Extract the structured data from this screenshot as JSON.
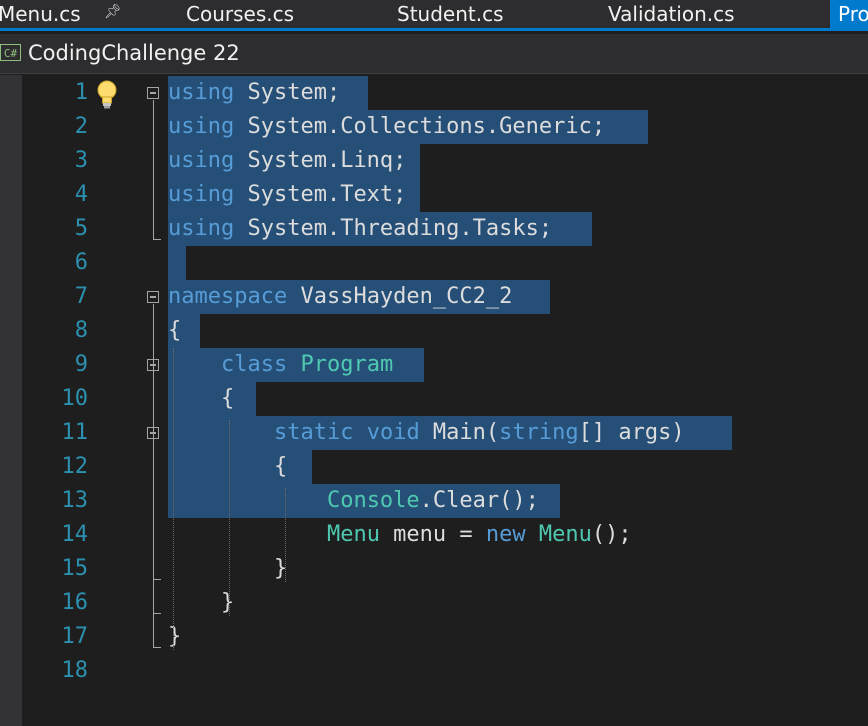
{
  "tabs": [
    {
      "label": "Menu.cs"
    },
    {
      "label": "Courses.cs"
    },
    {
      "label": "Student.cs"
    },
    {
      "label": "Validation.cs"
    },
    {
      "label": "Pro"
    }
  ],
  "pin_icon": "pin-icon",
  "navbar": {
    "language_badge": "C#",
    "project": "CodingChallenge 22"
  },
  "editor": {
    "line_numbers": [
      "1",
      "2",
      "3",
      "4",
      "5",
      "6",
      "7",
      "8",
      "9",
      "10",
      "11",
      "12",
      "13",
      "14",
      "15",
      "16",
      "17",
      "18"
    ],
    "lines": [
      [
        {
          "t": "using",
          "c": "kw"
        },
        {
          "t": " System;"
        }
      ],
      [
        {
          "t": "using",
          "c": "kw"
        },
        {
          "t": " System.Collections.Generic;"
        }
      ],
      [
        {
          "t": "using",
          "c": "kw"
        },
        {
          "t": " System.Linq;"
        }
      ],
      [
        {
          "t": "using",
          "c": "kw"
        },
        {
          "t": " System.Text;"
        }
      ],
      [
        {
          "t": "using",
          "c": "kw"
        },
        {
          "t": " System.Threading.Tasks;"
        }
      ],
      [],
      [
        {
          "t": "namespace",
          "c": "kw"
        },
        {
          "t": " VassHayden_CC2_2"
        }
      ],
      [
        {
          "t": "{"
        }
      ],
      [
        {
          "t": "    "
        },
        {
          "t": "class",
          "c": "kw"
        },
        {
          "t": " "
        },
        {
          "t": "Program",
          "c": "ty"
        }
      ],
      [
        {
          "t": "    {"
        }
      ],
      [
        {
          "t": "        "
        },
        {
          "t": "static",
          "c": "kw"
        },
        {
          "t": " "
        },
        {
          "t": "void",
          "c": "kw"
        },
        {
          "t": " Main("
        },
        {
          "t": "string",
          "c": "kw"
        },
        {
          "t": "[] args)"
        }
      ],
      [
        {
          "t": "        {"
        }
      ],
      [
        {
          "t": "            "
        },
        {
          "t": "Console",
          "c": "ty"
        },
        {
          "t": ".Clear();"
        }
      ],
      [
        {
          "t": "            "
        },
        {
          "t": "Menu",
          "c": "ty"
        },
        {
          "t": " menu = "
        },
        {
          "t": "new",
          "c": "kw"
        },
        {
          "t": " "
        },
        {
          "t": "Menu",
          "c": "ty"
        },
        {
          "t": "();"
        }
      ],
      [
        {
          "t": "        }"
        }
      ],
      [
        {
          "t": "    }"
        }
      ],
      [
        {
          "t": "}"
        }
      ],
      []
    ],
    "selection_color": "#264f78"
  },
  "lightbulb_icon": "lightbulb-icon"
}
